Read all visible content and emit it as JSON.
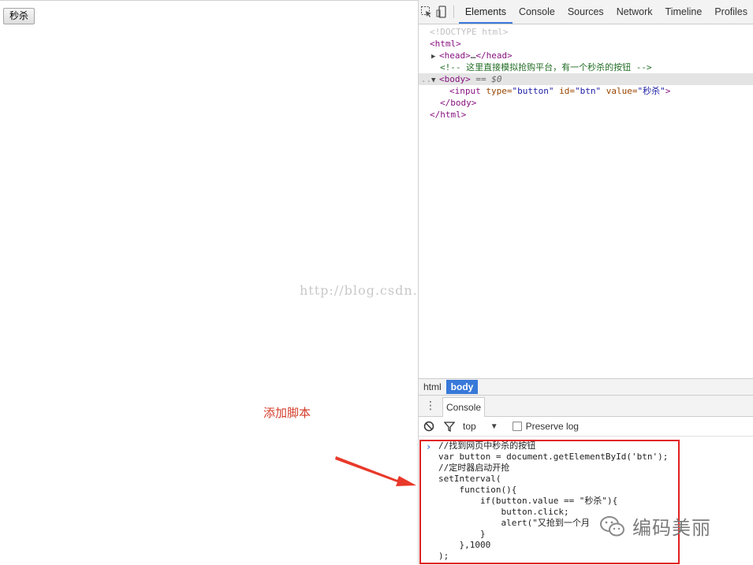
{
  "page": {
    "seckill_button": "秒杀",
    "watermark": "http://blog.csdn.net/",
    "annotation": "添加脚本"
  },
  "devtools": {
    "tabs": [
      "Elements",
      "Console",
      "Sources",
      "Network",
      "Timeline",
      "Profiles"
    ],
    "active_tab": "Elements",
    "dom": {
      "doctype": "<!DOCTYPE html>",
      "html_open": "<html>",
      "head_open": "<head>",
      "head_ellipsis": "…",
      "head_close": "</head>",
      "comment": "<!-- 这里直接模拟抢购平台，有一个秒杀的按钮 -->",
      "body_open": "<body>",
      "body_eq": "== $0",
      "dots": "...",
      "input_open": "<input ",
      "input_type_name": "type=",
      "input_type_val": "\"button\"",
      "input_id_name": "id=",
      "input_id_val": "\"btn\"",
      "input_value_name": "value=",
      "input_value_val": "\"秒杀\"",
      "input_close": ">",
      "body_close": "</body>",
      "html_close": "</html>"
    },
    "breadcrumbs": [
      "html",
      "body"
    ],
    "drawer_tab": "Console",
    "console_context": "top",
    "preserve_log_label": "Preserve log",
    "preserve_log_checked": false,
    "console_code": [
      "//找到网页中秒杀的按钮",
      "var button = document.getElementById('btn');",
      "//定时器启动开抢",
      "setInterval(",
      "    function(){",
      "        if(button.value == \"秒杀\"){",
      "            button.click;",
      "            alert(\"又抢到一个月",
      "        }",
      "    },1000",
      ");"
    ]
  },
  "wechat": {
    "account_name": "编码美丽"
  },
  "colors": {
    "accent": "#3879d9",
    "annotation_red": "#d43c2a",
    "highlight_border": "#e02020"
  }
}
